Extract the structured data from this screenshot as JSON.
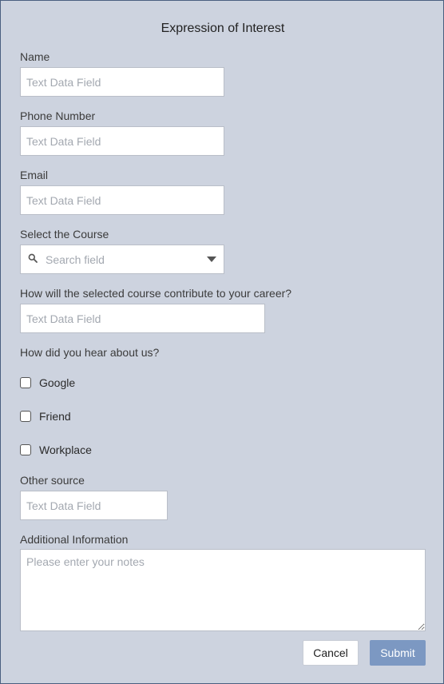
{
  "dialog": {
    "title": "Expression of Interest",
    "colors": {
      "background": "#cdd3df",
      "border": "#4a5f80",
      "submit": "#7c98c2"
    }
  },
  "fields": {
    "name": {
      "label": "Name",
      "placeholder": "Text Data Field",
      "value": ""
    },
    "phone": {
      "label": "Phone Number",
      "placeholder": "Text Data Field",
      "value": ""
    },
    "email": {
      "label": "Email",
      "placeholder": "Text Data Field",
      "value": ""
    },
    "course": {
      "label": "Select the Course",
      "placeholder": "Search field",
      "icon": "search-icon",
      "dropdown_icon": "caret-down-icon"
    },
    "career": {
      "label": "How will the selected course contribute to your career?",
      "placeholder": "Text Data Field",
      "value": ""
    },
    "hear": {
      "label": "How did you hear about us?",
      "options": [
        {
          "label": "Google",
          "checked": false
        },
        {
          "label": "Friend",
          "checked": false
        },
        {
          "label": "Workplace",
          "checked": false
        }
      ]
    },
    "other": {
      "label": "Other source",
      "placeholder": "Text Data Field",
      "value": ""
    },
    "notes": {
      "label": "Additional Information",
      "placeholder": "Please enter your notes",
      "value": ""
    }
  },
  "buttons": {
    "cancel": "Cancel",
    "submit": "Submit"
  }
}
